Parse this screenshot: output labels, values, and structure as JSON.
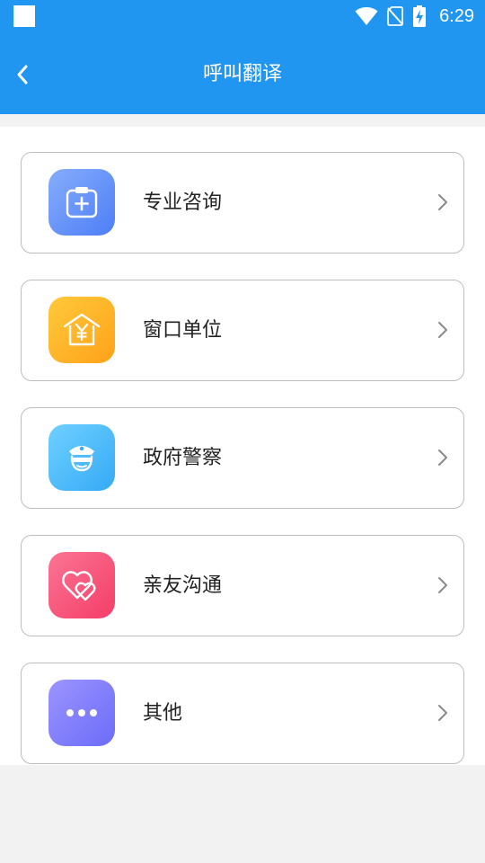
{
  "status_bar": {
    "time": "6:29",
    "icons": [
      "notification-square-icon",
      "wifi-icon",
      "no-sim-icon",
      "battery-charging-icon"
    ]
  },
  "header": {
    "title": "呼叫翻译",
    "back_icon": "chevron-left-icon",
    "background": "#2196f0"
  },
  "menu": {
    "items": [
      {
        "label": "专业咨询",
        "icon": "medical-clipboard-icon",
        "colors": [
          "#86adfb",
          "#4d7ef7"
        ]
      },
      {
        "label": "窗口单位",
        "icon": "yuan-house-icon",
        "colors": [
          "#ffc93a",
          "#ffa21a"
        ]
      },
      {
        "label": "政府警察",
        "icon": "police-officer-icon",
        "colors": [
          "#6fd0ff",
          "#35aaf6"
        ]
      },
      {
        "label": "亲友沟通",
        "icon": "double-heart-icon",
        "colors": [
          "#fb7593",
          "#f43d68"
        ]
      },
      {
        "label": "其他",
        "icon": "more-dots-icon",
        "colors": [
          "#9c94ff",
          "#6c6cf8"
        ]
      }
    ]
  }
}
